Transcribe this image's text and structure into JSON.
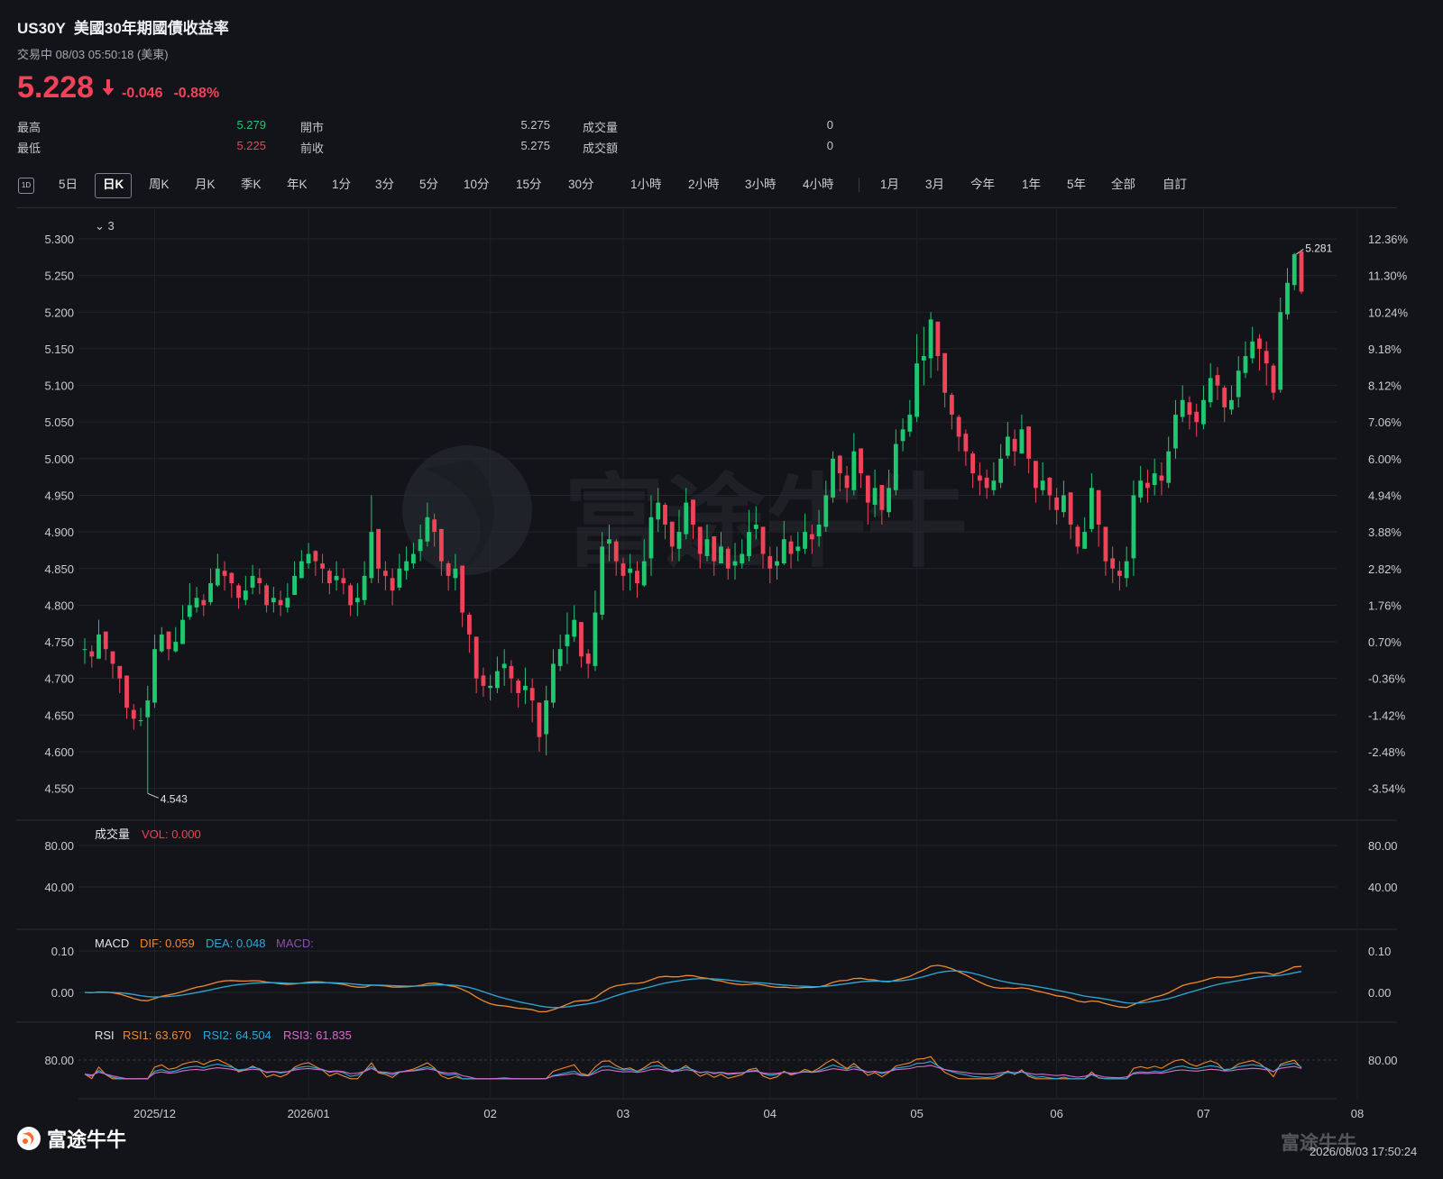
{
  "header": {
    "symbol": "US30Y",
    "name": "美國30年期國債收益率",
    "status": "交易中 08/03 05:50:18 (美東)",
    "price": "5.228",
    "change": "-0.046",
    "change_pct": "-0.88%"
  },
  "stats": {
    "high_label": "最高",
    "high_value": "5.279",
    "low_label": "最低",
    "low_value": "5.225",
    "open_label": "開市",
    "open_value": "5.275",
    "prev_label": "前收",
    "prev_value": "5.275",
    "volume_label": "成交量",
    "volume_value": "0",
    "turnover_label": "成交額",
    "turnover_value": "0"
  },
  "tabs": {
    "icon": "1D",
    "items": [
      "5日",
      "日K",
      "周K",
      "月K",
      "季K",
      "年K",
      "1分",
      "3分",
      "5分",
      "10分",
      "15分",
      "30分",
      "1小時",
      "2小時",
      "3小時",
      "4小時",
      "1月",
      "3月",
      "今年",
      "1年",
      "5年",
      "全部",
      "自訂"
    ],
    "active": "日K"
  },
  "watermark": "富途牛牛",
  "footer": {
    "logo_text": "富途牛牛",
    "watermark_text": "富途牛牛",
    "timestamp": "2026/08/03 17:50:24"
  },
  "colors": {
    "up": "#1ec870",
    "down": "#f0435a",
    "background": "#131419",
    "dif": "#f0892d",
    "dea": "#2ea8d8",
    "rsi3": "#d46ad0"
  },
  "chart_data": {
    "type": "candlestick",
    "main": {
      "collapse_label": "3",
      "y_ticks": [
        5.3,
        5.25,
        5.2,
        5.15,
        5.1,
        5.05,
        5.0,
        4.95,
        4.9,
        4.85,
        4.8,
        4.75,
        4.7,
        4.65,
        4.6,
        4.55
      ],
      "y_tick_labels": [
        "5.300",
        "5.250",
        "5.200",
        "5.150",
        "5.100",
        "5.050",
        "5.000",
        "4.950",
        "4.900",
        "4.850",
        "4.800",
        "4.750",
        "4.700",
        "4.650",
        "4.600",
        "4.550"
      ],
      "right_pct_labels": [
        "12.36%",
        "11.30%",
        "10.24%",
        "9.18%",
        "8.12%",
        "7.06%",
        "6.00%",
        "4.94%",
        "3.88%",
        "2.82%",
        "1.76%",
        "0.70%",
        "-0.36%",
        "-1.42%",
        "-2.48%",
        "-3.54%"
      ],
      "ylim": [
        4.5212,
        5.3208
      ],
      "max_label": "5.281",
      "max_value": 5.281,
      "min_label": "4.543",
      "min_value": 4.543,
      "x_labels": [
        "2025/12",
        "2026/01",
        "02",
        "03",
        "04",
        "05",
        "06",
        "07",
        "08"
      ],
      "x_label_index": [
        10,
        32,
        58,
        77,
        98,
        119,
        139,
        160,
        182
      ],
      "closes": [
        4.74,
        4.73,
        4.76,
        4.74,
        4.72,
        4.7,
        4.66,
        4.645,
        4.643,
        4.67,
        4.74,
        4.76,
        4.74,
        4.75,
        4.78,
        4.8,
        4.81,
        4.8,
        4.83,
        4.85,
        4.84,
        4.83,
        4.81,
        4.82,
        4.84,
        4.83,
        4.8,
        4.81,
        4.8,
        4.81,
        4.84,
        4.86,
        4.87,
        4.86,
        4.85,
        4.83,
        4.84,
        4.83,
        4.8,
        4.81,
        4.84,
        4.9,
        4.85,
        4.84,
        4.82,
        4.85,
        4.86,
        4.87,
        4.89,
        4.92,
        4.9,
        4.86,
        4.84,
        4.85,
        4.79,
        4.76,
        4.7,
        4.69,
        4.69,
        4.71,
        4.72,
        4.7,
        4.68,
        4.69,
        4.67,
        4.62,
        4.67,
        4.72,
        4.74,
        4.76,
        4.78,
        4.73,
        4.72,
        4.79,
        4.88,
        4.89,
        4.86,
        4.84,
        4.85,
        4.83,
        4.86,
        4.92,
        4.94,
        4.91,
        4.88,
        4.9,
        4.94,
        4.91,
        4.87,
        4.89,
        4.86,
        4.88,
        4.85,
        4.86,
        4.87,
        4.9,
        4.91,
        4.87,
        4.85,
        4.86,
        4.89,
        4.87,
        4.88,
        4.9,
        4.89,
        4.91,
        4.95,
        5.0,
        4.98,
        4.96,
        5.01,
        4.98,
        4.94,
        4.96,
        4.93,
        4.96,
        5.02,
        5.04,
        5.06,
        5.13,
        5.14,
        5.19,
        5.14,
        5.09,
        5.06,
        5.03,
        5.01,
        4.98,
        4.97,
        4.96,
        4.97,
        5.0,
        5.03,
        5.01,
        5.04,
        5.0,
        4.96,
        4.97,
        4.95,
        4.93,
        4.95,
        4.91,
        4.88,
        4.9,
        4.96,
        4.91,
        4.86,
        4.85,
        4.84,
        4.86,
        4.95,
        4.97,
        4.96,
        4.98,
        4.97,
        5.01,
        5.06,
        5.08,
        5.06,
        5.05,
        5.08,
        5.11,
        5.1,
        5.07,
        5.08,
        5.12,
        5.14,
        5.16,
        5.15,
        5.13,
        5.09,
        5.2,
        5.24,
        5.279,
        5.228
      ],
      "highs": [
        4.755,
        4.745,
        4.78,
        4.76,
        4.735,
        4.715,
        4.69,
        4.665,
        4.66,
        4.69,
        4.76,
        4.77,
        4.755,
        4.77,
        4.8,
        4.83,
        4.825,
        4.815,
        4.85,
        4.87,
        4.86,
        4.845,
        4.83,
        4.84,
        4.855,
        4.85,
        4.83,
        4.825,
        4.82,
        4.83,
        4.86,
        4.875,
        4.885,
        4.875,
        4.87,
        4.85,
        4.86,
        4.85,
        4.83,
        4.83,
        4.86,
        4.95,
        4.9,
        4.86,
        4.85,
        4.87,
        4.88,
        4.885,
        4.91,
        4.94,
        4.925,
        4.89,
        4.86,
        4.87,
        4.83,
        4.79,
        4.73,
        4.715,
        4.705,
        4.73,
        4.74,
        4.725,
        4.7,
        4.715,
        4.7,
        4.66,
        4.69,
        4.74,
        4.76,
        4.79,
        4.8,
        4.76,
        4.74,
        4.82,
        4.9,
        4.91,
        4.89,
        4.865,
        4.87,
        4.86,
        4.89,
        4.95,
        4.96,
        4.94,
        4.91,
        4.93,
        4.96,
        4.935,
        4.9,
        4.91,
        4.885,
        4.9,
        4.88,
        4.885,
        4.89,
        4.93,
        4.935,
        4.9,
        4.88,
        4.88,
        4.915,
        4.895,
        4.9,
        4.925,
        4.91,
        4.93,
        4.97,
        5.01,
        5.005,
        4.99,
        5.035,
        5.01,
        4.97,
        4.985,
        4.96,
        4.985,
        5.04,
        5.055,
        5.08,
        5.17,
        5.18,
        5.2,
        5.17,
        5.12,
        5.09,
        5.06,
        5.04,
        5.01,
        4.995,
        4.985,
        4.995,
        5.02,
        5.05,
        5.04,
        5.06,
        5.03,
        4.99,
        4.995,
        4.975,
        4.96,
        4.97,
        4.95,
        4.91,
        4.92,
        4.98,
        4.94,
        4.9,
        4.88,
        4.86,
        4.88,
        4.97,
        4.99,
        4.985,
        5.0,
        4.995,
        5.03,
        5.08,
        5.1,
        5.085,
        5.075,
        5.1,
        5.13,
        5.125,
        5.1,
        5.1,
        5.14,
        5.16,
        5.18,
        5.17,
        5.16,
        5.13,
        5.22,
        5.26,
        5.281,
        5.28
      ],
      "lows": [
        4.72,
        4.715,
        4.73,
        4.725,
        4.7,
        4.68,
        4.645,
        4.63,
        4.635,
        4.543,
        4.66,
        4.735,
        4.725,
        4.735,
        4.76,
        4.78,
        4.79,
        4.785,
        4.8,
        4.825,
        4.82,
        4.81,
        4.795,
        4.8,
        4.815,
        4.815,
        4.79,
        4.79,
        4.785,
        4.79,
        4.815,
        4.84,
        4.85,
        4.84,
        4.83,
        4.815,
        4.82,
        4.815,
        4.785,
        4.785,
        4.8,
        4.83,
        4.83,
        4.82,
        4.8,
        4.82,
        4.835,
        4.85,
        4.86,
        4.88,
        4.88,
        4.84,
        4.82,
        4.82,
        4.77,
        4.735,
        4.68,
        4.675,
        4.67,
        4.68,
        4.69,
        4.68,
        4.66,
        4.665,
        4.64,
        4.6,
        4.595,
        4.66,
        4.71,
        4.72,
        4.75,
        4.715,
        4.7,
        4.71,
        4.78,
        4.86,
        4.84,
        4.82,
        4.82,
        4.81,
        4.825,
        4.84,
        4.9,
        4.89,
        4.86,
        4.86,
        4.89,
        4.89,
        4.85,
        4.86,
        4.84,
        4.86,
        4.835,
        4.835,
        4.85,
        4.86,
        4.89,
        4.85,
        4.83,
        4.835,
        4.855,
        4.85,
        4.86,
        4.87,
        4.87,
        4.88,
        4.9,
        4.94,
        4.955,
        4.94,
        4.95,
        4.96,
        4.91,
        4.92,
        4.91,
        4.92,
        4.95,
        5.01,
        5.03,
        5.05,
        5.1,
        5.11,
        5.12,
        5.07,
        5.04,
        5.01,
        4.99,
        4.96,
        4.95,
        4.945,
        4.95,
        4.96,
        5.0,
        4.99,
        5.01,
        4.98,
        4.94,
        4.95,
        4.93,
        4.91,
        4.92,
        4.89,
        4.87,
        4.88,
        4.9,
        4.88,
        4.84,
        4.83,
        4.82,
        4.825,
        4.84,
        4.94,
        4.94,
        4.95,
        4.95,
        4.96,
        5.0,
        5.05,
        5.04,
        5.03,
        5.04,
        5.07,
        5.08,
        5.05,
        5.06,
        5.07,
        5.11,
        5.13,
        5.12,
        5.1,
        5.08,
        5.09,
        5.19,
        5.23,
        5.225
      ]
    },
    "volume": {
      "label": "成交量",
      "value_label": "VOL: 0.000",
      "y_tick_labels": [
        "80.00",
        "40.00"
      ]
    },
    "macd": {
      "label": "MACD",
      "dif_label": "DIF: 0.059",
      "dea_label": "DEA: 0.048",
      "macd_label": "MACD:",
      "y_tick_labels": [
        "0.10",
        "0.00"
      ],
      "ylim": [
        -0.045,
        0.115
      ]
    },
    "rsi": {
      "label": "RSI",
      "rsi1_label": "RSI1: 63.670",
      "rsi2_label": "RSI2: 64.504",
      "rsi3_label": "RSI3: 61.835",
      "y_tick_labels": [
        "80.00"
      ],
      "ylim": [
        35,
        90
      ]
    }
  }
}
